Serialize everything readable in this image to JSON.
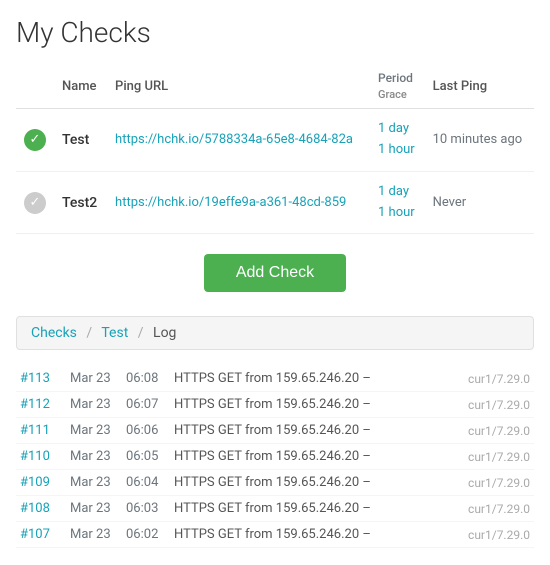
{
  "page": {
    "title": "My Checks"
  },
  "table": {
    "headers": {
      "name": "Name",
      "ping_url": "Ping URL",
      "period": "Period",
      "grace": "Grace",
      "last_ping": "Last Ping"
    },
    "rows": [
      {
        "status": "green",
        "name": "Test",
        "ping_url": "https://hchk.io/5788334a-65e8-4684-82a",
        "period": "1 day",
        "grace": "1 hour",
        "last_ping": "10 minutes ago"
      },
      {
        "status": "gray",
        "name": "Test2",
        "ping_url": "https://hchk.io/19effe9a-a361-48cd-859",
        "period": "1 day",
        "grace": "1 hour",
        "last_ping": "Never"
      }
    ]
  },
  "add_check_button": "Add Check",
  "breadcrumb": {
    "checks": "Checks",
    "test": "Test",
    "log": "Log"
  },
  "log": {
    "rows": [
      {
        "num": "#113",
        "date": "Mar 23",
        "time": "06:08",
        "desc": "HTTPS GET from 159.65.246.20 –",
        "version": "cur1/7.29.0"
      },
      {
        "num": "#112",
        "date": "Mar 23",
        "time": "06:07",
        "desc": "HTTPS GET from 159.65.246.20 –",
        "version": "cur1/7.29.0"
      },
      {
        "num": "#111",
        "date": "Mar 23",
        "time": "06:06",
        "desc": "HTTPS GET from 159.65.246.20 –",
        "version": "cur1/7.29.0"
      },
      {
        "num": "#110",
        "date": "Mar 23",
        "time": "06:05",
        "desc": "HTTPS GET from 159.65.246.20 –",
        "version": "cur1/7.29.0"
      },
      {
        "num": "#109",
        "date": "Mar 23",
        "time": "06:04",
        "desc": "HTTPS GET from 159.65.246.20 –",
        "version": "cur1/7.29.0"
      },
      {
        "num": "#108",
        "date": "Mar 23",
        "time": "06:03",
        "desc": "HTTPS GET from 159.65.246.20 –",
        "version": "cur1/7.29.0"
      },
      {
        "num": "#107",
        "date": "Mar 23",
        "time": "06:02",
        "desc": "HTTPS GET from 159.65.246.20 –",
        "version": "cur1/7.29.0"
      }
    ]
  }
}
